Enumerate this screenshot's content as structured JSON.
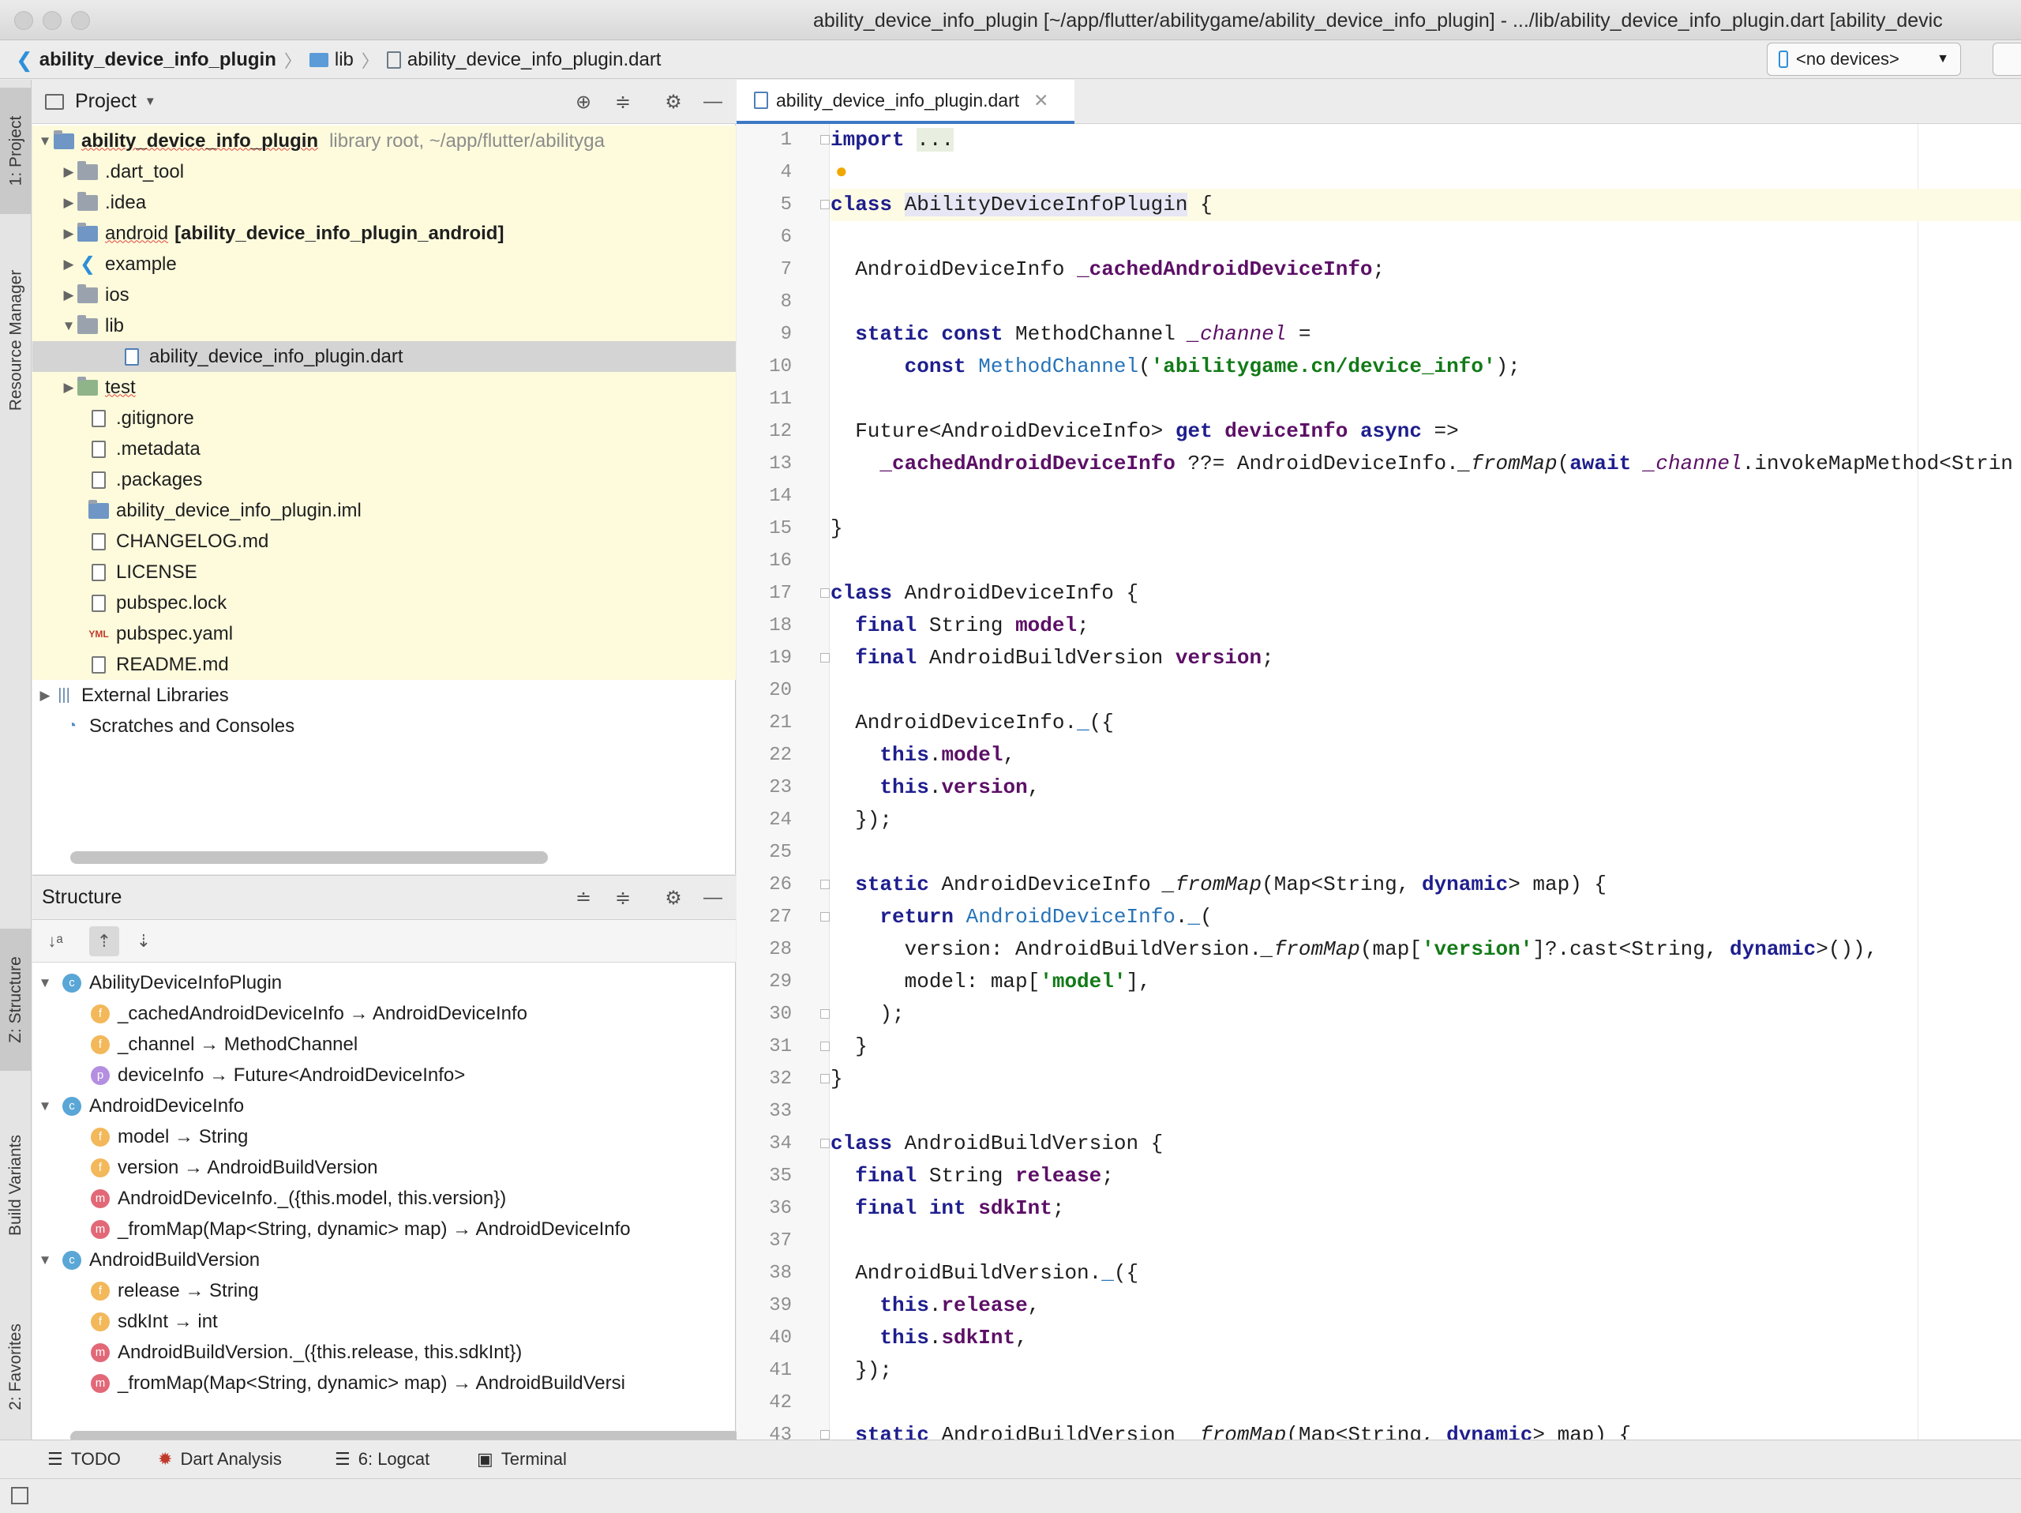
{
  "window": {
    "title": "ability_device_info_plugin [~/app/flutter/abilitygame/ability_device_info_plugin] - .../lib/ability_device_info_plugin.dart [ability_devic"
  },
  "breadcrumb": [
    "ability_device_info_plugin",
    "lib",
    "ability_device_info_plugin.dart"
  ],
  "device_selector": {
    "label": "<no devices>"
  },
  "left_tabs": [
    "1: Project",
    "Resource Manager",
    "Z: Structure",
    "Build Variants",
    "2: Favorites"
  ],
  "project": {
    "header": "Project",
    "items": [
      {
        "label": "ability_device_info_plugin",
        "detail": "library root, ~/app/flutter/abilityga"
      },
      {
        "label": ".dart_tool"
      },
      {
        "label": ".idea"
      },
      {
        "label": "android",
        "detail": "[ability_device_info_plugin_android]"
      },
      {
        "label": "example"
      },
      {
        "label": "ios"
      },
      {
        "label": "lib"
      },
      {
        "label": "ability_device_info_plugin.dart"
      },
      {
        "label": "test"
      },
      {
        "label": ".gitignore"
      },
      {
        "label": ".metadata"
      },
      {
        "label": ".packages"
      },
      {
        "label": "ability_device_info_plugin.iml"
      },
      {
        "label": "CHANGELOG.md"
      },
      {
        "label": "LICENSE"
      },
      {
        "label": "pubspec.lock"
      },
      {
        "label": "pubspec.yaml"
      },
      {
        "label": "README.md"
      },
      {
        "label": "External Libraries"
      },
      {
        "label": "Scratches and Consoles"
      }
    ]
  },
  "structure": {
    "header": "Structure",
    "items": [
      {
        "label": "AbilityDeviceInfoPlugin",
        "kind": "c"
      },
      {
        "label": "_cachedAndroidDeviceInfo → AndroidDeviceInfo",
        "kind": "f"
      },
      {
        "label": "_channel → MethodChannel",
        "kind": "f"
      },
      {
        "label": "deviceInfo → Future<AndroidDeviceInfo>",
        "kind": "p"
      },
      {
        "label": "AndroidDeviceInfo",
        "kind": "c"
      },
      {
        "label": "model → String",
        "kind": "f"
      },
      {
        "label": "version → AndroidBuildVersion",
        "kind": "f"
      },
      {
        "label": "AndroidDeviceInfo._({this.model, this.version})",
        "kind": "m"
      },
      {
        "label": "_fromMap(Map<String, dynamic> map) → AndroidDeviceInfo",
        "kind": "m"
      },
      {
        "label": "AndroidBuildVersion",
        "kind": "c"
      },
      {
        "label": "release → String",
        "kind": "f"
      },
      {
        "label": "sdkInt → int",
        "kind": "f"
      },
      {
        "label": "AndroidBuildVersion._({this.release, this.sdkInt})",
        "kind": "m"
      },
      {
        "label": "_fromMap(Map<String, dynamic> map) → AndroidBuildVersi",
        "kind": "m"
      }
    ]
  },
  "editor": {
    "tab": "ability_device_info_plugin.dart",
    "line_numbers": [
      "1",
      "4",
      "5",
      "6",
      "7",
      "8",
      "9",
      "10",
      "11",
      "12",
      "13",
      "14",
      "15",
      "16",
      "17",
      "18",
      "19",
      "20",
      "21",
      "22",
      "23",
      "24",
      "25",
      "26",
      "27",
      "28",
      "29",
      "30",
      "31",
      "32",
      "33",
      "34",
      "35",
      "36",
      "37",
      "38",
      "39",
      "40",
      "41",
      "42",
      "43"
    ]
  },
  "bottom_tabs": [
    "TODO",
    "Dart Analysis",
    "6: Logcat",
    "Terminal"
  ],
  "colors": {
    "accent": "#3d78c6",
    "keyword": "#1e1e8e",
    "string": "#127a17",
    "field": "#5c0f66",
    "highlight": "#fdfbe4"
  }
}
